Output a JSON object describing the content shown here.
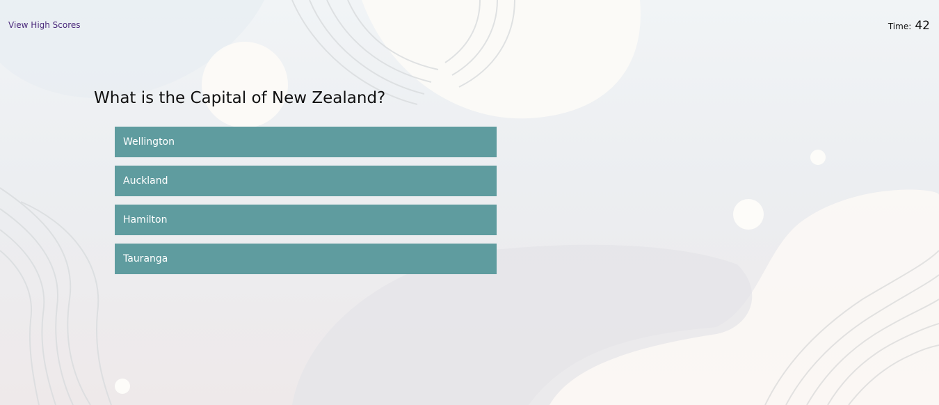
{
  "header": {
    "high_scores_label": "View High Scores",
    "timer_label": "Time:",
    "timer_value": "42"
  },
  "quiz": {
    "question": "What is the Capital of New Zealand?",
    "answers": [
      "Wellington",
      "Auckland",
      "Hamilton",
      "Tauranga"
    ]
  },
  "colors": {
    "answer_button_bg": "#5f9c9f",
    "answer_button_text": "#ffffff",
    "link": "#4b2a7b"
  }
}
